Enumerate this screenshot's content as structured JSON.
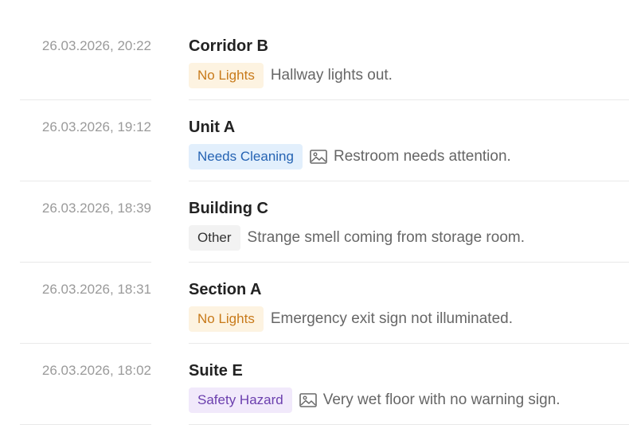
{
  "colors": {
    "no_lights_bg": "#fdf3e1",
    "no_lights_fg": "#c87a1a",
    "needs_cleaning_bg": "#e2effc",
    "needs_cleaning_fg": "#2563b3",
    "other_bg": "#f2f2f2",
    "other_fg": "#333333",
    "safety_hazard_bg": "#f1e9fb",
    "safety_hazard_fg": "#6b3fae"
  },
  "entries": [
    {
      "timestamp": "26.03.2026, 20:22",
      "location": "Corridor B",
      "category": "No Lights",
      "category_key": "no_lights",
      "has_image": false,
      "description": "Hallway lights out."
    },
    {
      "timestamp": "26.03.2026, 19:12",
      "location": "Unit A",
      "category": "Needs Cleaning",
      "category_key": "needs_cleaning",
      "has_image": true,
      "image_icon": "image-icon",
      "description": "Restroom needs attention."
    },
    {
      "timestamp": "26.03.2026, 18:39",
      "location": "Building C",
      "category": "Other",
      "category_key": "other",
      "has_image": false,
      "description": "Strange smell coming from storage room."
    },
    {
      "timestamp": "26.03.2026, 18:31",
      "location": "Section A",
      "category": "No Lights",
      "category_key": "no_lights",
      "has_image": false,
      "description": "Emergency exit sign not illuminated."
    },
    {
      "timestamp": "26.03.2026, 18:02",
      "location": "Suite E",
      "category": "Safety Hazard",
      "category_key": "safety_hazard",
      "has_image": true,
      "image_icon": "image-icon",
      "description": "Very wet floor with no warning sign."
    }
  ]
}
